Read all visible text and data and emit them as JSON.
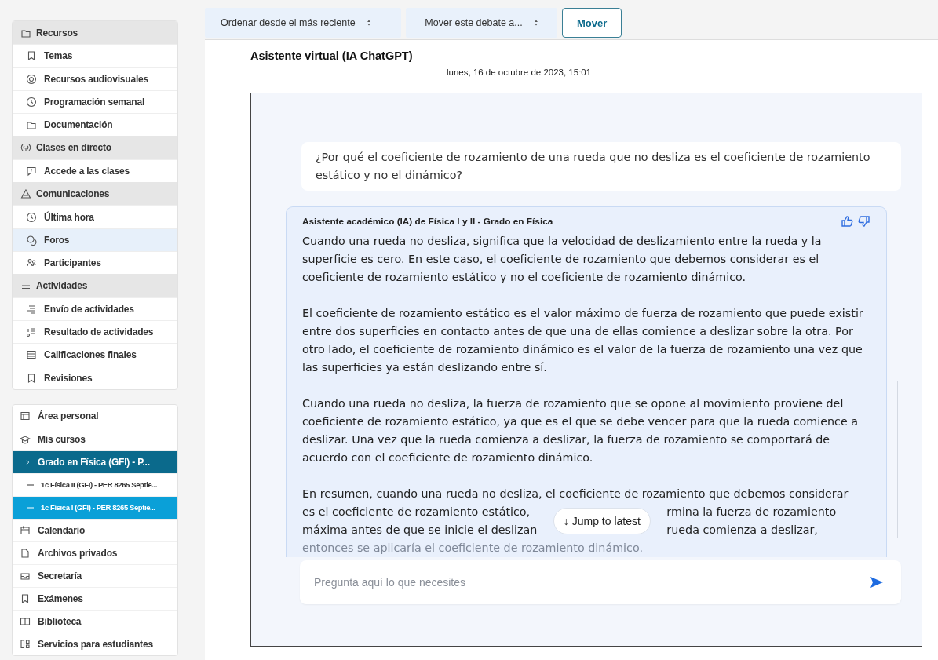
{
  "sidebar": {
    "groups": [
      {
        "heading": "Recursos",
        "items": [
          {
            "label": "Temas",
            "selected": false
          },
          {
            "label": "Recursos audiovisuales",
            "selected": false
          },
          {
            "label": "Programación semanal",
            "selected": false
          },
          {
            "label": "Documentación",
            "selected": false
          }
        ]
      },
      {
        "heading": "Clases en directo",
        "items": [
          {
            "label": "Accede a las clases",
            "selected": false
          }
        ]
      },
      {
        "heading": "Comunicaciones",
        "items": [
          {
            "label": "Última hora",
            "selected": false
          },
          {
            "label": "Foros",
            "selected": true
          },
          {
            "label": "Participantes",
            "selected": false
          }
        ]
      },
      {
        "heading": "Actividades",
        "items": [
          {
            "label": "Envío de actividades",
            "selected": false
          },
          {
            "label": "Resultado de actividades",
            "selected": false
          },
          {
            "label": "Calificaciones finales",
            "selected": false
          },
          {
            "label": "Revisiones",
            "selected": false
          }
        ]
      }
    ],
    "nav": [
      {
        "kind": "item",
        "label": "Área personal",
        "selected": false
      },
      {
        "kind": "item",
        "label": "Mis cursos",
        "selected": false
      },
      {
        "kind": "course",
        "label": "Grado en Física (GFI) - P...",
        "selected": false
      },
      {
        "kind": "subcourse",
        "label": "1c Física II (GFI) - PER 8265 Septie...",
        "selected": false
      },
      {
        "kind": "subcourse",
        "label": "1c Física I (GFI) - PER 8265 Septie...",
        "selected": true
      },
      {
        "kind": "item",
        "label": "Calendario",
        "selected": false
      },
      {
        "kind": "item",
        "label": "Archivos privados",
        "selected": false
      },
      {
        "kind": "item",
        "label": "Secretaría",
        "selected": false
      },
      {
        "kind": "item",
        "label": "Exámenes",
        "selected": false
      },
      {
        "kind": "item",
        "label": "Biblioteca",
        "selected": false
      },
      {
        "kind": "item",
        "label": "Servicios para estudiantes",
        "selected": false
      }
    ]
  },
  "toolbar": {
    "sort_select": "Ordenar desde el más reciente",
    "move_select": "Mover este debate a...",
    "move_button": "Mover"
  },
  "post": {
    "author": "Asistente virtual (IA ChatGPT)",
    "date": "lunes, 16 de octubre de 2023, 15:01"
  },
  "chat": {
    "question": "¿Por qué el coeficiente de rozamiento de una rueda que no desliza es el coeficiente de rozamiento estático y no el dinámico?",
    "answer_title": "Asistente académico (IA) de Física I y II - Grado en Física",
    "paragraphs": [
      "Cuando una rueda no desliza, significa que la velocidad de deslizamiento entre la rueda y la superficie es cero. En este caso, el coeficiente de rozamiento que debemos considerar es el coeficiente de rozamiento estático y no el coeficiente de rozamiento dinámico.",
      "El coeficiente de rozamiento estático es el valor máximo de fuerza de rozamiento que puede existir entre dos superficies en contacto antes de que una de ellas comience a deslizar sobre la otra. Por otro lado, el coeficiente de rozamiento dinámico es el valor de la fuerza de rozamiento una vez que las superficies ya están deslizando entre sí.",
      "Cuando una rueda no desliza, la fuerza de rozamiento que se opone al movimiento proviene del coeficiente de rozamiento estático, ya que es el que se debe vencer para que la rueda comience a deslizar. Una vez que la rueda comienza a deslizar, la fuerza de rozamiento se comportará de acuerdo con el coeficiente de rozamiento dinámico."
    ],
    "covered_lines": [
      [
        "En resumen, cuando una rueda no desliza, el coeficiente de rozamiento que debemos considerar"
      ],
      [
        "es el coeficiente de rozamiento estático,",
        "rmina la fuerza de rozamiento"
      ],
      [
        "máxima antes de que se inicie el deslizan",
        "rueda comienza a deslizar,"
      ],
      [
        "entonces se aplicaría el coeficiente de rozamiento dinámico."
      ]
    ],
    "jump_button": "↓ Jump to latest",
    "input_placeholder": "Pregunta aquí lo que necesites"
  }
}
